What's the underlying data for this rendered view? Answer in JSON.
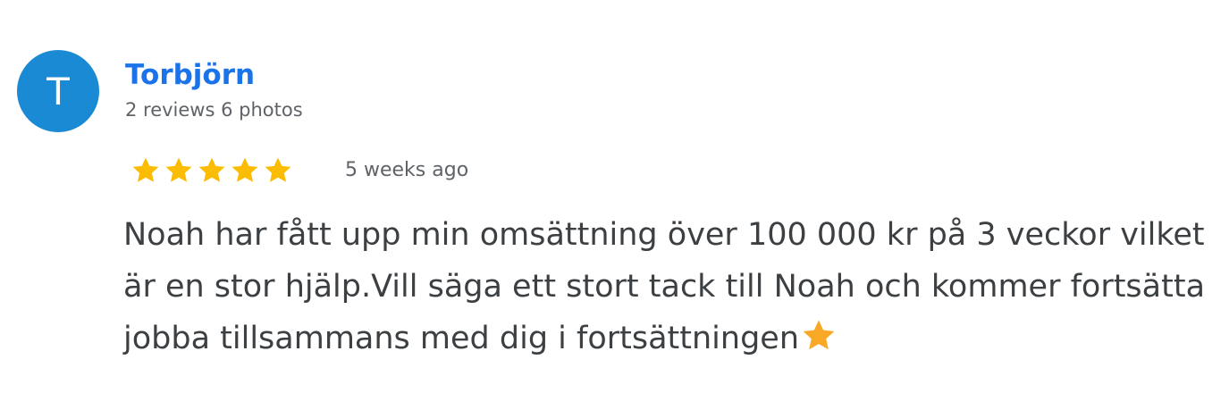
{
  "review": {
    "avatar_letter": "T",
    "author_name": "Torbjörn",
    "author_meta": "2 reviews 6 photos",
    "rating": 5,
    "rating_max": 5,
    "time_ago": "5 weeks ago",
    "text": "Noah har fått upp min omsättning över 100 000 kr på 3 veckor vilket är en stor hjälp.Vill säga ett stort tack till Noah och kommer fortsätta jobba tillsammans med dig i fortsättningen",
    "trailing_emoji": "star-emoji"
  },
  "colors": {
    "avatar_bg": "#1a8ad4",
    "author_name": "#1a73e8",
    "star": "#fbbc04",
    "emoji_star": "#f9a825",
    "meta_text": "#5f6368",
    "body_text": "#3c4043"
  },
  "icons": {
    "rating_star": "star-icon",
    "emoji": "star-emoji-icon"
  }
}
